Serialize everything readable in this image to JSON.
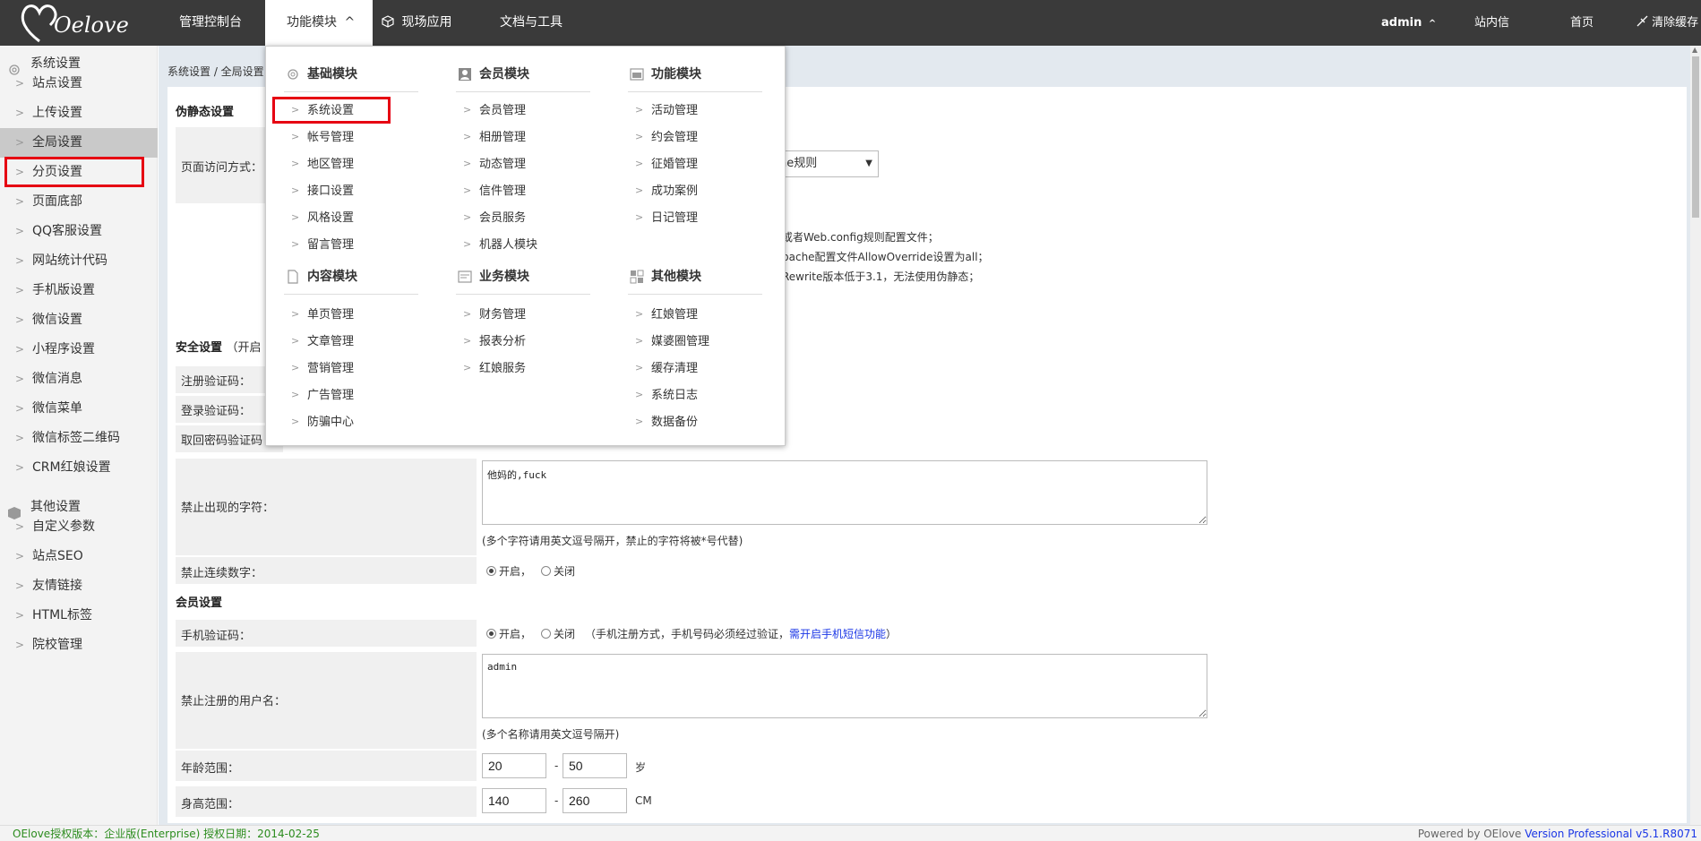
{
  "topbar": {
    "logo_text": "Oelove",
    "nav": [
      "管理控制台",
      "功能模块",
      "现场应用",
      "文档与工具"
    ],
    "nav_active_caret": "^",
    "user": "admin",
    "user_caret": "^",
    "links": [
      "站内信",
      "首页",
      "清除缓存"
    ]
  },
  "sidebar": {
    "group1": "系统设置",
    "group1_items": [
      "站点设置",
      "上传设置",
      "全局设置",
      "分页设置",
      "页面底部",
      "QQ客服设置",
      "网站统计代码",
      "手机版设置",
      "微信设置",
      "小程序设置",
      "微信消息",
      "微信菜单",
      "微信标签二维码",
      "CRM红娘设置"
    ],
    "group2": "其他设置",
    "group2_items": [
      "自定义参数",
      "站点SEO",
      "友情链接",
      "HTML标签",
      "院校管理"
    ],
    "chevron": ">"
  },
  "breadcrumb": "系统设置 / 全局设置",
  "content": {
    "section1": "伪静态设置",
    "row_page_access": "页面访问方式：",
    "select_value": "he规则",
    "select_arrow": "▼",
    "notes": [
      "或者Web.config规则配置文件；",
      "pache配置文件AllowOverride设置为all；",
      "Rewrite版本低于3.1，无法使用伪静态；"
    ],
    "section2": "安全设置",
    "section2_hint": "（开启",
    "row_reg_code": "注册验证码：",
    "row_login_code": "登录验证码：",
    "row_pwd_code": "取回密码验证码",
    "row_forbid_chars": "禁止出现的字符：",
    "forbid_chars_value": "他妈的,fuck",
    "forbid_chars_note": "(多个字符请用英文逗号隔开，禁止的字符将被*号代替)",
    "row_forbid_digits": "禁止连续数字：",
    "radio_on": "开启",
    "radio_sep": "，",
    "radio_off": "关闭",
    "section3": "会员设置",
    "row_mobile_code": "手机验证码：",
    "mobile_note_pre": "（手机注册方式，手机号码必须经过验证，",
    "mobile_note_link": "需开启手机短信功能",
    "mobile_note_post": "）",
    "row_forbid_users": "禁止注册的用户名：",
    "forbid_users_value": "admin",
    "forbid_users_note": "(多个名称请用英文逗号隔开)",
    "row_age": "年龄范围：",
    "age_min": "20",
    "age_max": "50",
    "age_unit": "岁",
    "range_dash": "-",
    "row_height": "身高范围：",
    "height_min": "140",
    "height_max": "260",
    "height_unit": "CM"
  },
  "mega_menu": {
    "col1_head1": "基础模块",
    "col1_items1": [
      "系统设置",
      "帐号管理",
      "地区管理",
      "接口设置",
      "风格设置",
      "留言管理"
    ],
    "col1_head2": "内容模块",
    "col1_items2": [
      "单页管理",
      "文章管理",
      "营销管理",
      "广告管理",
      "防骗中心"
    ],
    "col2_head1": "会员模块",
    "col2_items1": [
      "会员管理",
      "相册管理",
      "动态管理",
      "信件管理",
      "会员服务",
      "机器人模块"
    ],
    "col2_head2": "业务模块",
    "col2_items2": [
      "财务管理",
      "报表分析",
      "红娘服务"
    ],
    "col3_head1": "功能模块",
    "col3_items1": [
      "活动管理",
      "约会管理",
      "征婚管理",
      "成功案例",
      "日记管理"
    ],
    "col3_head2": "其他模块",
    "col3_items2": [
      "红娘管理",
      "媒婆圈管理",
      "缓存清理",
      "系统日志",
      "数据备份"
    ]
  },
  "footer": {
    "left": "OElove授权版本：企业版(Enterprise) 授权日期：2014-02-25",
    "right_pre": "Powered by OElove ",
    "right_version": "Version Professional v5.1.R8071"
  },
  "colors": {
    "topbar_bg": "#3a3a3a",
    "highlight_red": "#e60012",
    "footer_green": "#2c8c1e",
    "link_blue": "#1a36e6"
  }
}
